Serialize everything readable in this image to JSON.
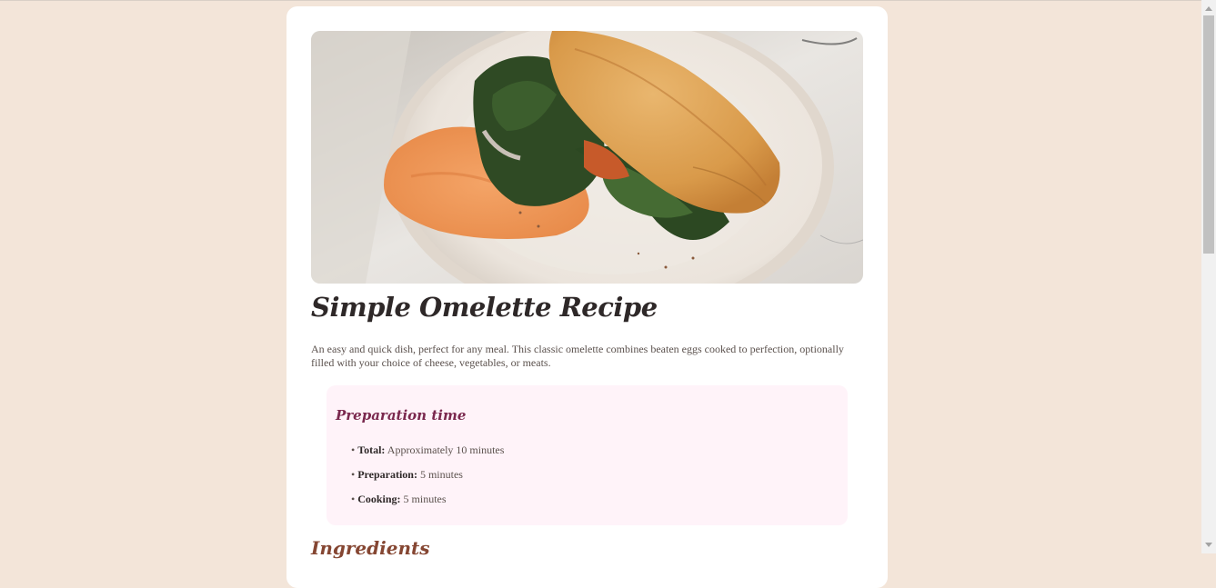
{
  "recipe": {
    "title": "Simple Omelette Recipe",
    "description": "An easy and quick dish, perfect for any meal. This classic omelette combines beaten eggs cooked to perfection, optionally filled with your choice of cheese, vegetables, or meats."
  },
  "preparation": {
    "title": "Preparation time",
    "items": [
      {
        "label": "Total:",
        "value": "Approximately 10 minutes"
      },
      {
        "label": "Preparation:",
        "value": "5 minutes"
      },
      {
        "label": "Cooking:",
        "value": "5 minutes"
      }
    ]
  },
  "ingredients": {
    "title": "Ingredients"
  },
  "colors": {
    "page_background": "#f3e5d9",
    "card_background": "#ffffff",
    "title": "#2e2828",
    "prep_background": "#fff3f9",
    "prep_title": "#7a284e",
    "section_title": "#854632"
  }
}
